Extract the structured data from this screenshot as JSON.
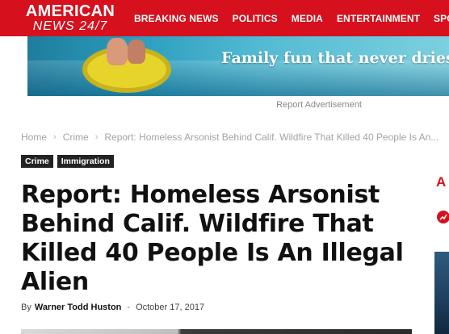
{
  "logo": {
    "line1": "AMERICAN",
    "line2": "NEWS 24/7"
  },
  "nav": {
    "items": [
      "BREAKING NEWS",
      "POLITICS",
      "MEDIA",
      "ENTERTAINMENT",
      "SPORTS"
    ]
  },
  "ad": {
    "headline": "Family fun that never dries",
    "label": "Report Advertisement"
  },
  "breadcrumb": {
    "home": "Home",
    "category": "Crime",
    "current": "Report: Homeless Arsonist Behind Calif. Wildfire That Killed 40 People Is An..."
  },
  "tags": [
    "Crime",
    "Immigration"
  ],
  "article": {
    "title": "Report: Homeless Arsonist Behind Calif. Wildfire That Killed 40 People Is An Illegal Alien",
    "by_label": "By",
    "author": "Warner Todd Huston",
    "separator": "-",
    "date": "October 17, 2017"
  },
  "sidebar": {
    "letter": "A"
  },
  "colors": {
    "brand_red": "#d6101d",
    "tag_bg": "#222222"
  }
}
